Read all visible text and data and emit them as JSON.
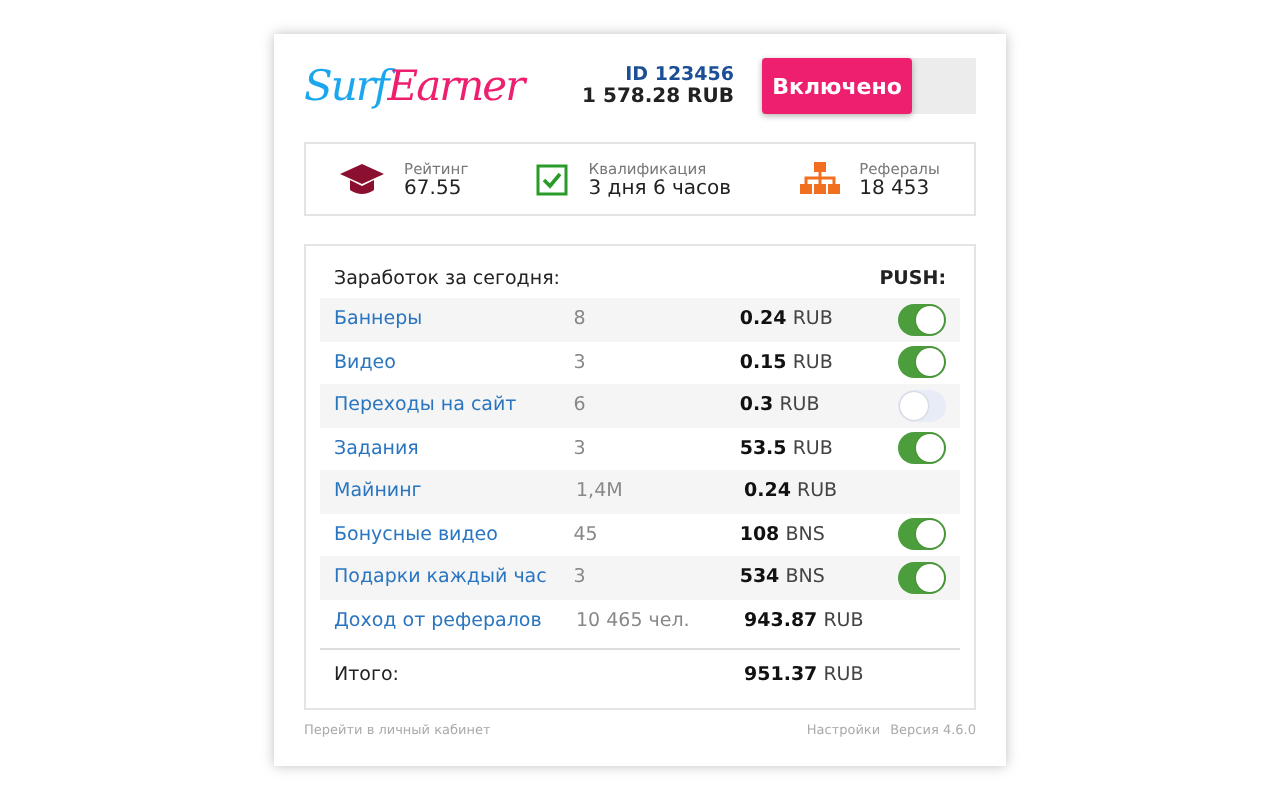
{
  "logo": {
    "part_1": "Surf",
    "part_2": "Earner"
  },
  "account": {
    "id": "ID 123456",
    "balance": "1 578.28 RUB"
  },
  "power_button": {
    "label": "Включено",
    "on": true
  },
  "stats": [
    {
      "kind": "rating",
      "label": "Рейтинг",
      "value": "67.55"
    },
    {
      "kind": "qualification",
      "label": "Квалификация",
      "value": "3 дня 6 часов"
    },
    {
      "kind": "referrals",
      "label": "Рефералы",
      "value": "18 453"
    }
  ],
  "earnings": {
    "title": "Заработок за сегодня:",
    "push_header": "PUSH:",
    "rows": [
      {
        "label": "Баннеры",
        "count": "8",
        "amount": "0.24",
        "unit": "RUB",
        "kind": "toggle",
        "push": true
      },
      {
        "label": "Видео",
        "count": "3",
        "amount": "0.15",
        "unit": "RUB",
        "kind": "toggle",
        "push": true
      },
      {
        "label": "Переходы на сайт",
        "count": "6",
        "amount": "0.3",
        "unit": "RUB",
        "kind": "toggle",
        "push": false
      },
      {
        "label": "Задания",
        "count": "3",
        "amount": "53.5",
        "unit": "RUB",
        "kind": "toggle",
        "push": true
      },
      {
        "label": "Майнинг",
        "count": "1,4M",
        "amount": "0.24",
        "unit": "RUB",
        "kind": "plain"
      },
      {
        "label": "Бонусные видео",
        "count": "45",
        "amount": "108",
        "unit": "BNS",
        "kind": "toggle",
        "push": true
      },
      {
        "label": "Подарки каждый час",
        "count": "3",
        "amount": "534",
        "unit": "BNS",
        "kind": "toggle",
        "push": true
      },
      {
        "label": "Доход от рефералов",
        "count": "10 465 чел.",
        "amount": "943.87",
        "unit": "RUB",
        "kind": "plain"
      }
    ],
    "total": {
      "label": "Итого:",
      "amount": "951.37",
      "unit": "RUB"
    }
  },
  "footer": {
    "cabinet_link": "Перейти в личный кабинет",
    "settings_link": "Настройки",
    "version": "Версия 4.6.0"
  }
}
